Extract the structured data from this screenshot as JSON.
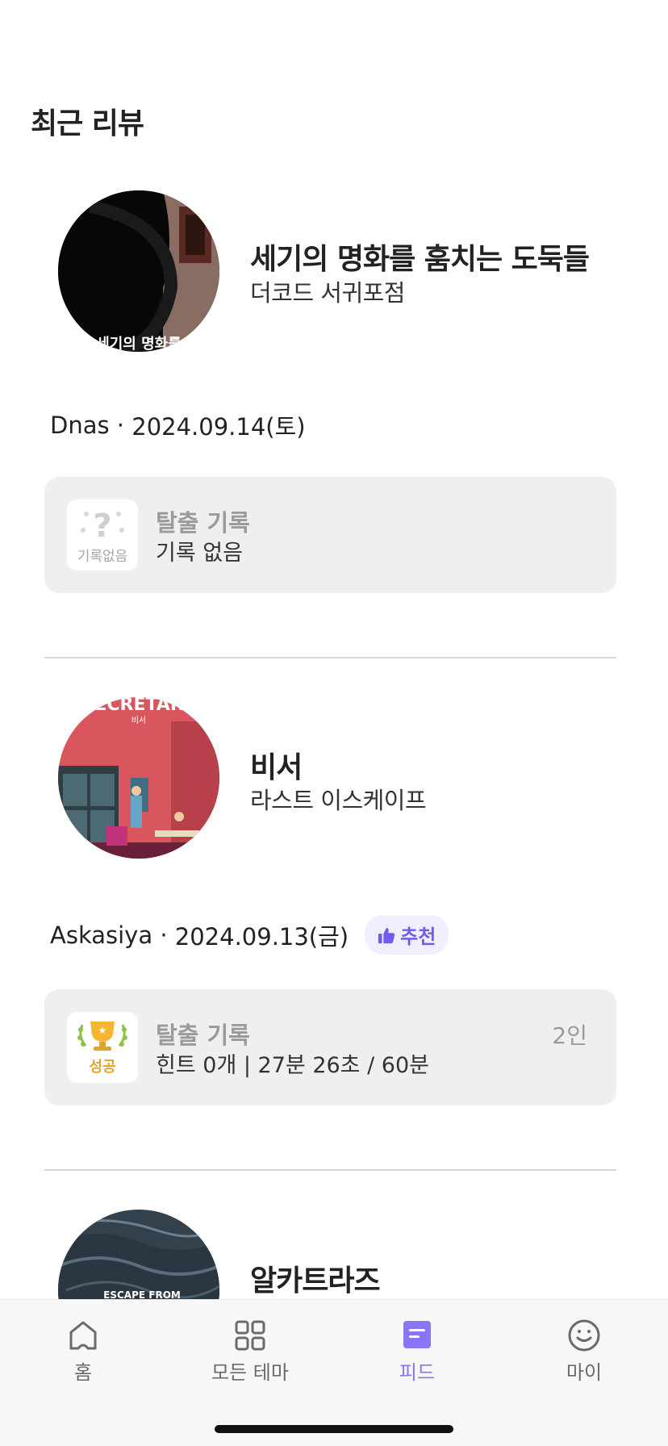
{
  "header": {
    "title": "최근 리뷰"
  },
  "reviews": [
    {
      "theme_title": "세기의 명화를 훔치는 도둑들",
      "store": "더코드 서귀포점",
      "thumb_text": "세기의 명화를",
      "author": "Dnas",
      "date": "2024.09.14(토)",
      "record": {
        "title": "탈출 기록",
        "detail": "기록 없음",
        "icon_label": "기록없음",
        "icon": "question-icon"
      }
    },
    {
      "theme_title": "비서",
      "store": "라스트 이스케이프",
      "thumb_text": "SECRETARY",
      "thumb_subtext": "비서",
      "author": "Askasiya",
      "date": "2024.09.13(금)",
      "badge": {
        "label": "추천",
        "icon": "thumbs-up-icon"
      },
      "record": {
        "title": "탈출 기록",
        "detail": "힌트 0개 | 27분 26초 / 60분",
        "people": "2인",
        "icon_label": "성공",
        "icon": "trophy-icon"
      }
    },
    {
      "theme_title": "알카트라즈",
      "thumb_text": "ESCAPE FROM"
    }
  ],
  "tabbar": {
    "items": [
      {
        "label": "홈",
        "icon": "home-icon",
        "active": false
      },
      {
        "label": "모든 테마",
        "icon": "grid-icon",
        "active": false
      },
      {
        "label": "피드",
        "icon": "feed-icon",
        "active": true
      },
      {
        "label": "마이",
        "icon": "smile-icon",
        "active": false
      }
    ]
  },
  "colors": {
    "accent": "#8a76f5",
    "badge_bg": "#f1efff",
    "card_bg": "#efefef",
    "success": "#e0a42a"
  }
}
